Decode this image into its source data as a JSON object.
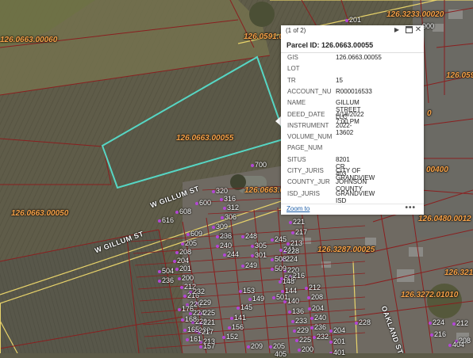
{
  "popup": {
    "pager": "(1 of 2)",
    "title": "Parcel ID: 126.0663.00055",
    "zoom_link": "Zoom to",
    "more": "•••",
    "icons": [
      "play-next-icon",
      "dock-icon",
      "close-icon"
    ],
    "attributes": [
      {
        "key": "GIS",
        "value": "126.0663.00055"
      },
      {
        "key": "LOT",
        "value": ""
      },
      {
        "key": "TR",
        "value": "15"
      },
      {
        "key": "ACCOUNT_NU",
        "value": "R000016533"
      },
      {
        "key": "NAME",
        "value": "GILLUM STREET LLC"
      },
      {
        "key": "DEED_DATE",
        "value": "4/18/2022 7:00 PM"
      },
      {
        "key": "INSTRUMENT",
        "value": "2022-13602"
      },
      {
        "key": "VOLUME_NUM",
        "value": ""
      },
      {
        "key": "PAGE_NUM",
        "value": ""
      },
      {
        "key": "SITUS",
        "value": "8201 CR 403"
      },
      {
        "key": "CITY_JURIS",
        "value": "CITY OF GRANDVIEW"
      },
      {
        "key": "COUNTY_JUR",
        "value": "JOHNSON COUNTY"
      },
      {
        "key": "ISD_JURIS",
        "value": "GRANDVIEW ISD"
      }
    ]
  },
  "map": {
    "selection_color": "#56d6c4",
    "parcel_line_color": "#8a1f1f",
    "road_color": "#e8d36a",
    "parcel_ids": [
      "126.0663.00060",
      "126.0591.0",
      "126.3233.00020",
      "126.059",
      "126.0663.00055",
      "126.0663.00050",
      "126.0663.00",
      "126.3287.00025",
      "126.0480.0012",
      "126.3219",
      "126.3272.01010",
      "00400",
      "0"
    ],
    "streets": [
      "W GILLUM ST",
      "W GILLUM ST",
      "OAKLAND ST"
    ],
    "addresses": [
      "201",
      "900",
      "700",
      "320",
      "316",
      "312",
      "608",
      "600",
      "616",
      "306",
      "303",
      "309",
      "609",
      "205",
      "208",
      "204",
      "201",
      "200",
      "212",
      "216",
      "220",
      "224",
      "228",
      "232",
      "236",
      "240",
      "244",
      "248",
      "305",
      "301",
      "249",
      "245",
      "241",
      "508",
      "509",
      "505",
      "501",
      "504",
      "236",
      "232",
      "229",
      "225",
      "221",
      "217",
      "213",
      "176",
      "168",
      "165",
      "161",
      "157",
      "153",
      "149",
      "145",
      "141",
      "156",
      "152",
      "148",
      "144",
      "140",
      "136",
      "233",
      "229",
      "225",
      "221",
      "217",
      "213",
      "228",
      "224",
      "220",
      "216",
      "212",
      "208",
      "204",
      "240",
      "236",
      "232",
      "228",
      "224",
      "216",
      "212",
      "208",
      "204",
      "201",
      "200",
      "209",
      "205",
      "404",
      "401",
      "405",
      "501",
      "400",
      "402",
      "401",
      "300",
      "301",
      "300",
      "408",
      "209",
      "205",
      "200"
    ]
  }
}
